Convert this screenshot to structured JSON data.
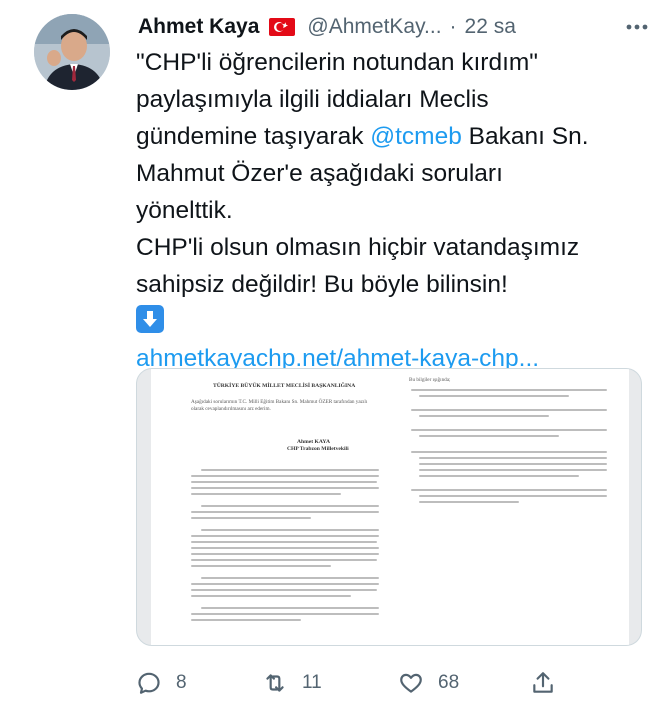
{
  "author": {
    "name": "Ahmet Kaya",
    "handle": "@AhmetKay...",
    "separator": "·",
    "time": "22 sa"
  },
  "tweet": {
    "lines": [
      "\"CHP'li öğrencilerin notundan kırdım\"",
      "paylaşımıyla ilgili iddiaları Meclis",
      "gündemine taşıyarak ",
      "Mahmut Özer'e aşağıdaki soruları",
      "yönelttik.",
      "CHP'li olsun olmasın hiçbir vatandaşımız",
      "sahipsiz değildir! Bu böyle bilinsin!"
    ],
    "mention": "@tcmeb",
    "after_mention": " Bakanı Sn.",
    "link": "ahmetkayachp.net/ahmet-kaya-chp..."
  },
  "document": {
    "header": "TÜRKİYE BÜYÜK MİLLET MECLİSİ BAŞKANLIĞINA",
    "intro": "Aşağıdaki sorularımın T.C. Milli Eğitim Bakanı Sn. Mahmut ÖZER tarafından yazılı olarak cevaplandırılmasını arz ederim.",
    "signer_name": "Ahmet KAYA",
    "signer_title": "CHP Trabzon Milletvekili",
    "right_header": "Bu bilgiler ışığında;"
  },
  "actions": {
    "reply_count": "8",
    "retweet_count": "11",
    "like_count": "68"
  },
  "colors": {
    "accent": "#1d9bf0",
    "muted": "#536471",
    "text": "#0f1419"
  },
  "icons": [
    "more-icon",
    "turkey-flag-icon",
    "down-arrow-emoji-icon",
    "reply-icon",
    "retweet-icon",
    "like-icon",
    "share-icon"
  ]
}
